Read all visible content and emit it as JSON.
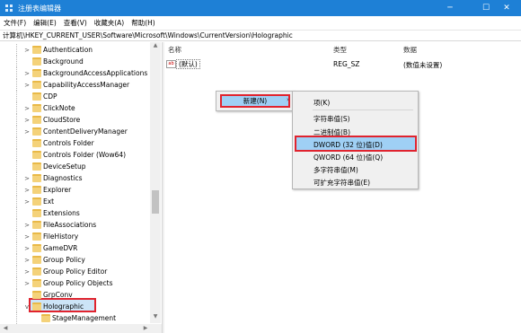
{
  "window": {
    "title": "注册表编辑器",
    "minimize": "─",
    "maximize": "☐",
    "close": "✕"
  },
  "menubar": {
    "items": [
      "文件(F)",
      "编辑(E)",
      "查看(V)",
      "收藏夹(A)",
      "帮助(H)"
    ]
  },
  "address": {
    "path": "计算机\\HKEY_CURRENT_USER\\Software\\Microsoft\\Windows\\CurrentVersion\\Holographic"
  },
  "tree": {
    "items": [
      "Authentication",
      "Background",
      "BackgroundAccessApplications",
      "CapabilityAccessManager",
      "CDP",
      "ClickNote",
      "CloudStore",
      "ContentDeliveryManager",
      "Controls Folder",
      "Controls Folder (Wow64)",
      "DeviceSetup",
      "Diagnostics",
      "Explorer",
      "Ext",
      "Extensions",
      "FileAssociations",
      "FileHistory",
      "GameDVR",
      "Group Policy",
      "Group Policy Editor",
      "Group Policy Objects",
      "GrpConv",
      "Holographic",
      "StageManagement"
    ],
    "selected": "Holographic"
  },
  "list": {
    "headers": {
      "name": "名称",
      "type": "类型",
      "data": "数据"
    },
    "rows": [
      {
        "icon": "ab",
        "name": "(默认)",
        "type": "REG_SZ",
        "data": "(数值未设置)"
      }
    ]
  },
  "context_menu": {
    "new_label": "新建(N)",
    "submenu_arrow": "›",
    "submenu": [
      "项(K)",
      "字符串值(S)",
      "二进制值(B)",
      "DWORD (32 位)值(D)",
      "QWORD (64 位)值(Q)",
      "多字符串值(M)",
      "可扩充字符串值(E)"
    ],
    "highlighted": "DWORD (32 位)值(D)"
  },
  "colors": {
    "titlebar": "#1e80d6",
    "highlight": "#9fd0f5",
    "annotation": "#e0232e",
    "folder": "#f4d27a"
  }
}
